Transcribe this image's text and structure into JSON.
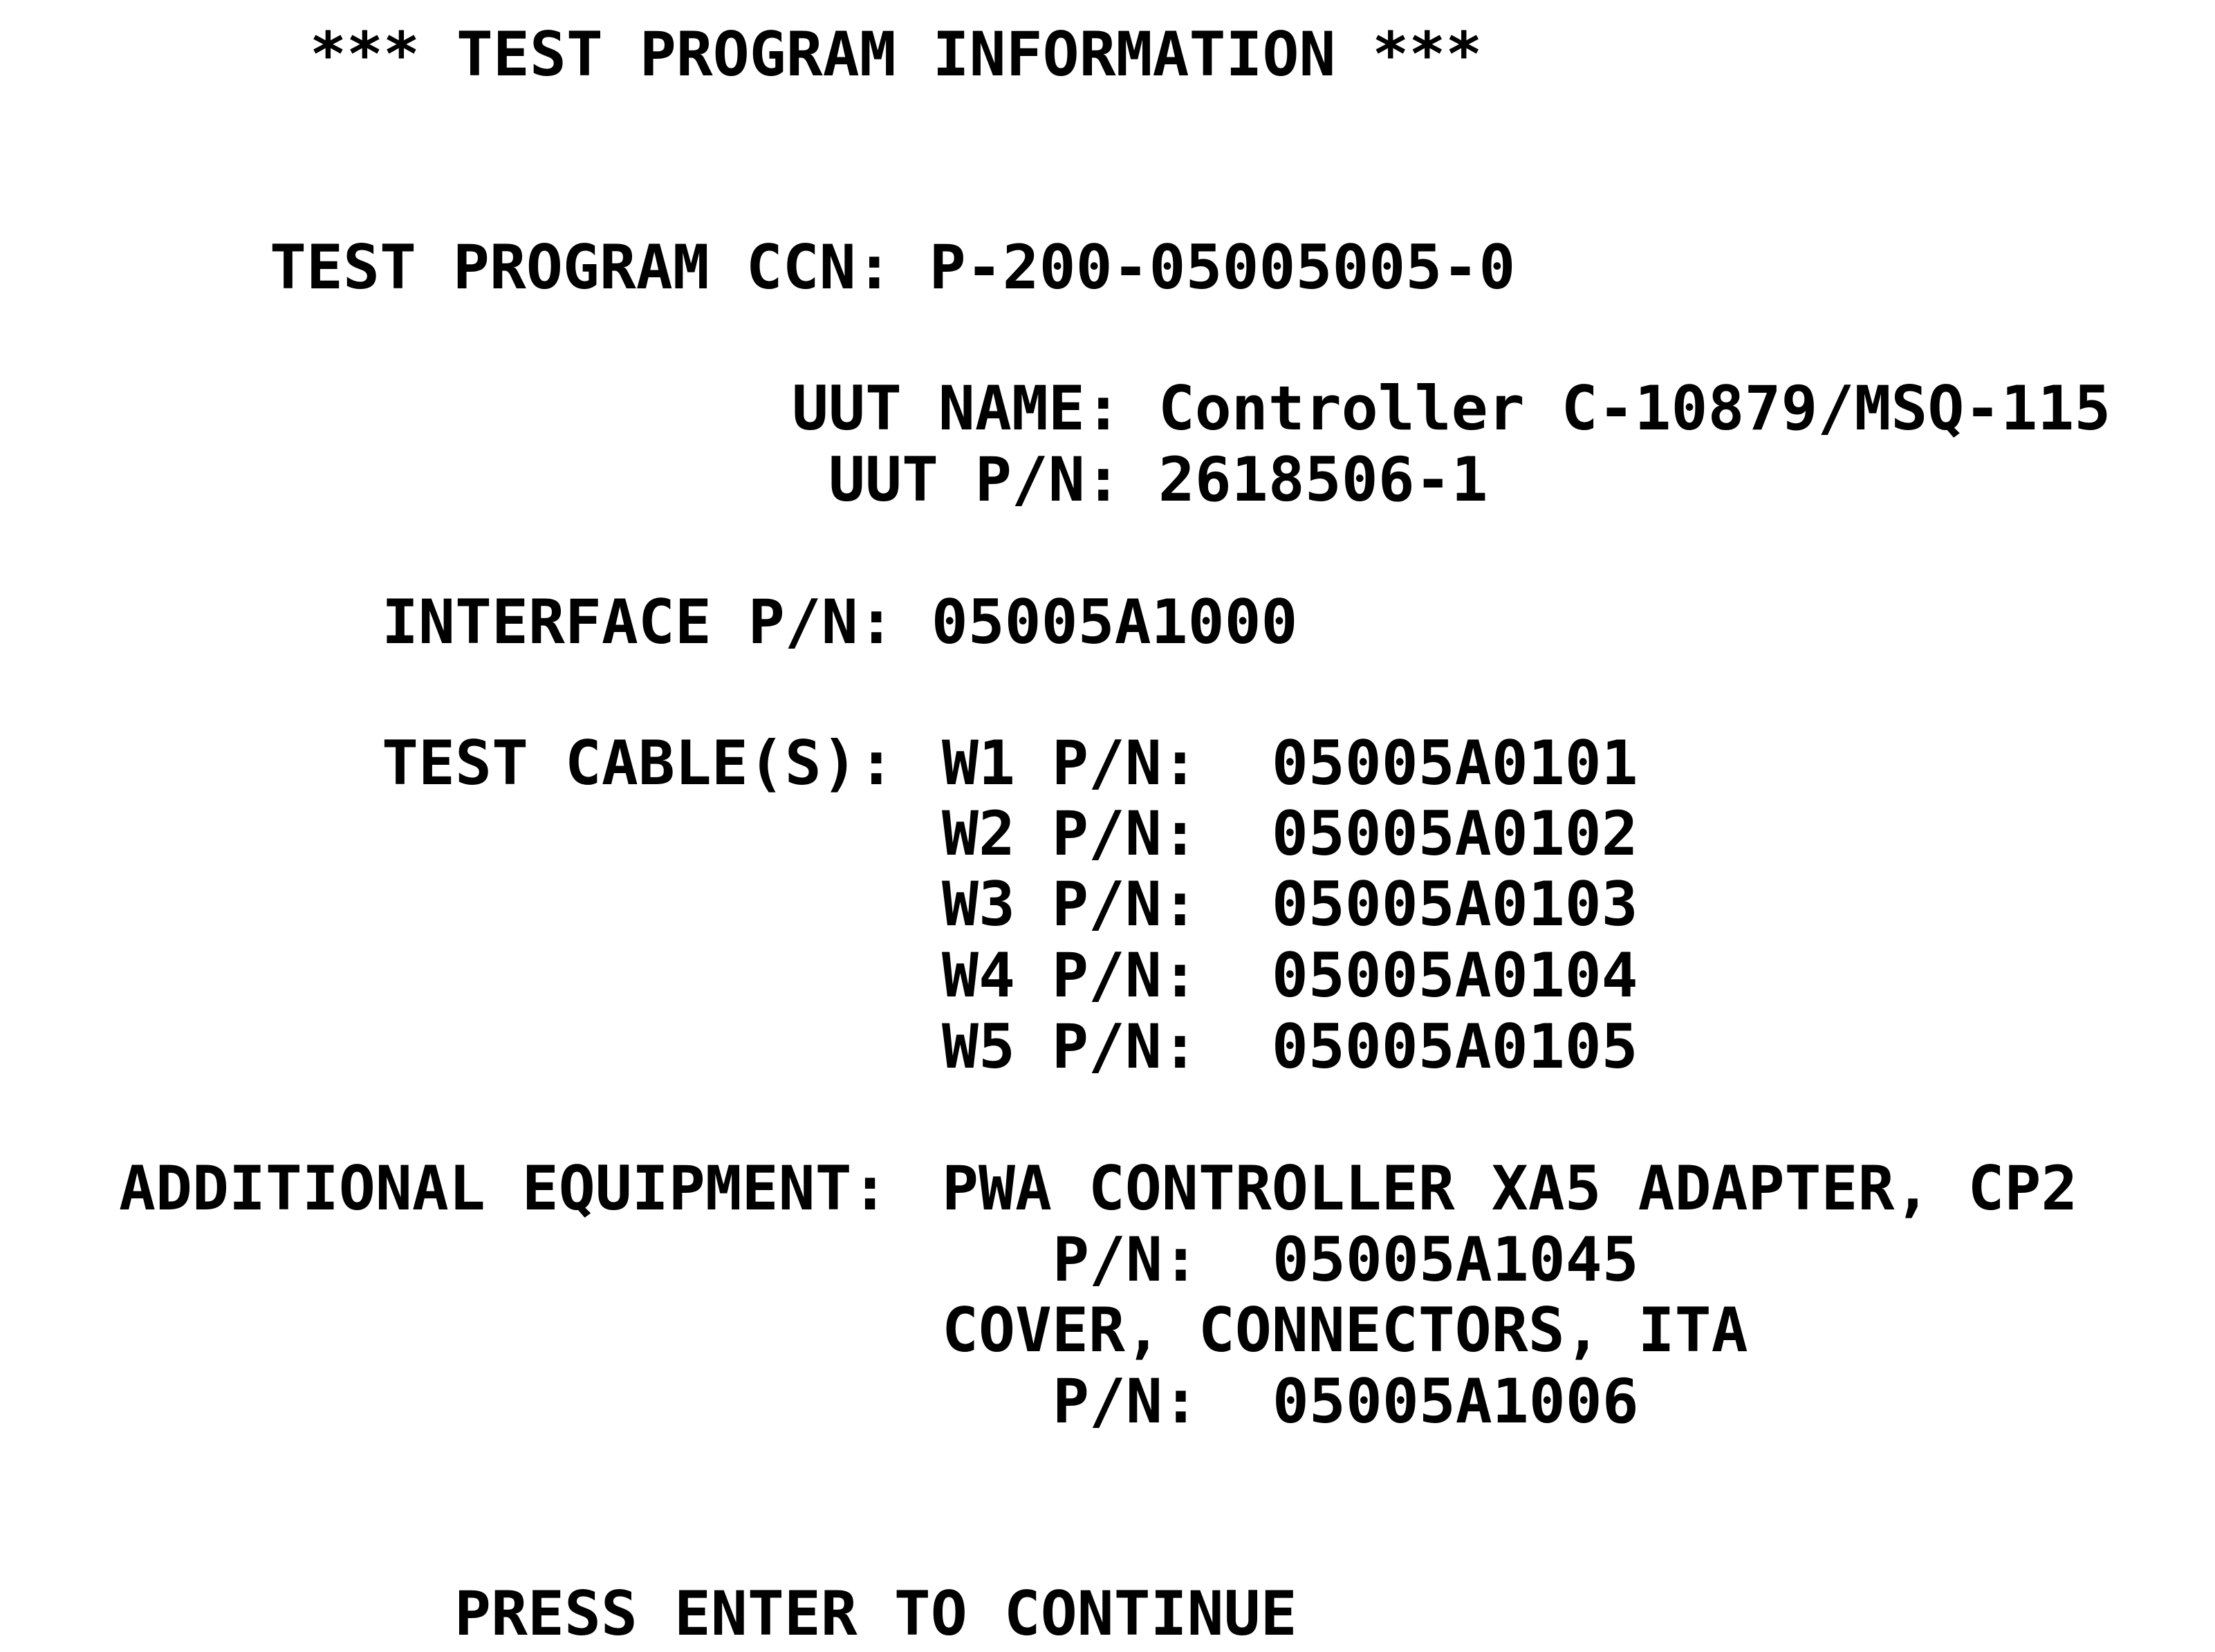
{
  "heading": "*** TEST PROGRAM INFORMATION ***",
  "ccn": {
    "label": "TEST PROGRAM CCN:",
    "value": "P-200-05005005-0"
  },
  "uut_name": {
    "label": "UUT NAME:",
    "value": "Controller C-10879/MSQ-115"
  },
  "uut_pn": {
    "label": "UUT P/N:",
    "value": "2618506-1"
  },
  "interface_pn": {
    "label": "INTERFACE P/N:",
    "value": "05005A1000"
  },
  "test_cables": {
    "label": "TEST CABLE(S):",
    "items": [
      {
        "id": "W1 P/N:",
        "pn": "05005A0101"
      },
      {
        "id": "W2 P/N:",
        "pn": "05005A0102"
      },
      {
        "id": "W3 P/N:",
        "pn": "05005A0103"
      },
      {
        "id": "W4 P/N:",
        "pn": "05005A0104"
      },
      {
        "id": "W5 P/N:",
        "pn": "05005A0105"
      }
    ]
  },
  "additional_equipment": {
    "label": "ADDITIONAL EQUIPMENT:",
    "items": [
      {
        "name": "PWA CONTROLLER XA5 ADAPTER, CP2",
        "pn_label": "P/N:",
        "pn": "05005A1045"
      },
      {
        "name": "COVER, CONNECTORS, ITA",
        "pn_label": "P/N:",
        "pn": "05005A1006"
      }
    ]
  },
  "prompt": "PRESS ENTER TO CONTINUE"
}
